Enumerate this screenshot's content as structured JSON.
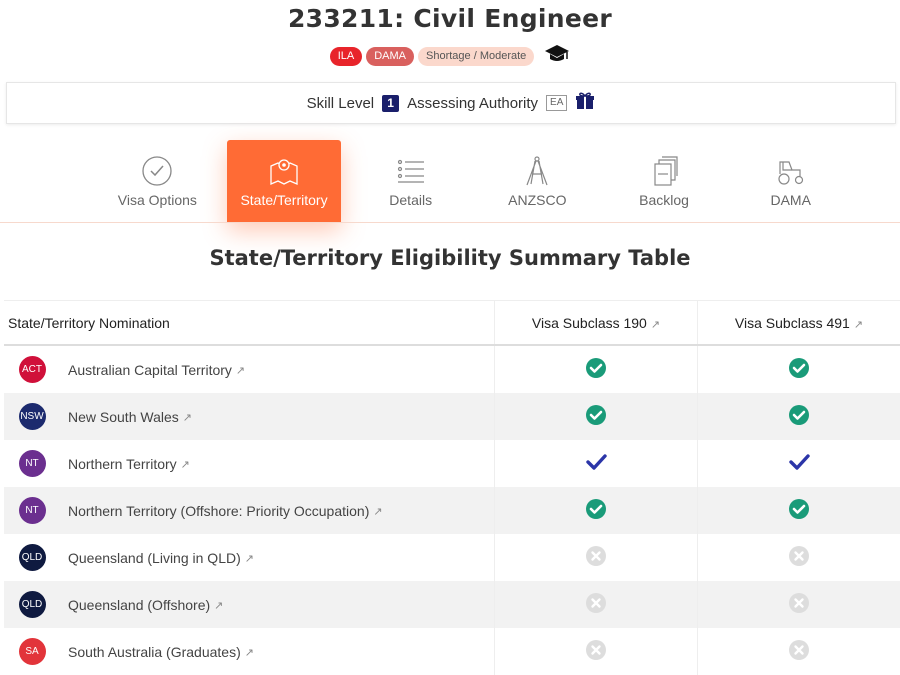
{
  "header": {
    "title": "233211: Civil Engineer",
    "badges": [
      "ILA",
      "DAMA",
      "Shortage / Moderate"
    ]
  },
  "skillbar": {
    "skill_level_label": "Skill Level",
    "skill_level_value": "1",
    "authority_label": "Assessing Authority",
    "authority_value": "EA"
  },
  "tabs": [
    {
      "label": "Visa Options",
      "icon": "check-circle-icon"
    },
    {
      "label": "State/Territory",
      "icon": "map-pin-icon",
      "active": true
    },
    {
      "label": "Details",
      "icon": "list-icon"
    },
    {
      "label": "ANZSCO",
      "icon": "compass-icon"
    },
    {
      "label": "Backlog",
      "icon": "documents-icon"
    },
    {
      "label": "DAMA",
      "icon": "tractor-icon"
    }
  ],
  "section_title": "State/Territory Eligibility Summary Table",
  "table": {
    "headers": [
      "State/Territory Nomination",
      "Visa Subclass 190",
      "Visa Subclass 491"
    ],
    "rows": [
      {
        "abbr": "ACT",
        "color": "#d0103a",
        "name": "Australian Capital Territory",
        "v190": "eligible",
        "v491": "eligible"
      },
      {
        "abbr": "NSW",
        "color": "#1c2a6e",
        "name": "New South Wales",
        "v190": "eligible",
        "v491": "eligible"
      },
      {
        "abbr": "NT",
        "color": "#6b2f8f",
        "name": "Northern Territory",
        "v190": "check",
        "v491": "check"
      },
      {
        "abbr": "NT",
        "color": "#6b2f8f",
        "name": "Northern Territory (Offshore: Priority Occupation)",
        "v190": "eligible",
        "v491": "eligible"
      },
      {
        "abbr": "QLD",
        "color": "#0f1a40",
        "name": "Queensland (Living in QLD)",
        "v190": "ineligible",
        "v491": "ineligible"
      },
      {
        "abbr": "QLD",
        "color": "#0f1a40",
        "name": "Queensland (Offshore)",
        "v190": "ineligible",
        "v491": "ineligible"
      },
      {
        "abbr": "SA",
        "color": "#e2343a",
        "name": "South Australia (Graduates)",
        "v190": "ineligible",
        "v491": "ineligible"
      }
    ]
  },
  "colors": {
    "accent": "#ff6b35",
    "eligible": "#1a9b79",
    "check": "#2b35a8",
    "ineligible": "#dddddd"
  }
}
